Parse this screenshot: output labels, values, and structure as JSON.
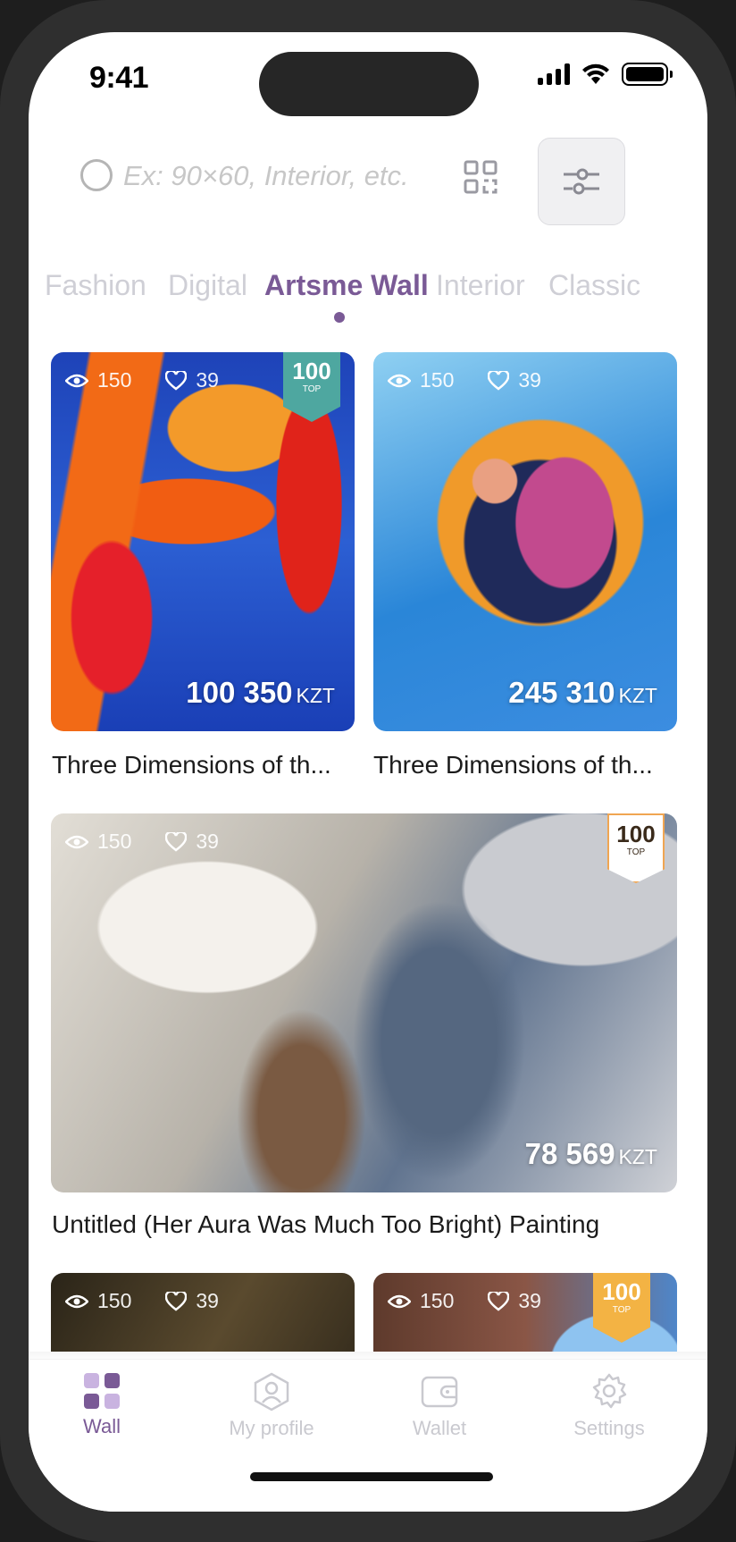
{
  "status_bar": {
    "time": "9:41"
  },
  "search": {
    "placeholder": "Ex: 90×60, Interior, etc.",
    "value": ""
  },
  "tabs": [
    {
      "label": "Fashion",
      "active": false
    },
    {
      "label": "Digital",
      "active": false
    },
    {
      "label": "Artsme Wall",
      "active": true
    },
    {
      "label": "Interior",
      "active": false
    },
    {
      "label": "Classic",
      "active": false
    }
  ],
  "cards": [
    {
      "views": "150",
      "likes": "39",
      "price": "100 350",
      "currency": "KZT",
      "title": "Three Dimensions of th...",
      "badge": {
        "number": "100",
        "label": "TOP"
      }
    },
    {
      "views": "150",
      "likes": "39",
      "price": "245 310",
      "currency": "KZT",
      "title": "Three Dimensions of th..."
    },
    {
      "views": "150",
      "likes": "39",
      "price": "78 569",
      "currency": "KZT",
      "title": "Untitled (Her Aura Was Much Too Bright) Painting",
      "badge": {
        "number": "100",
        "label": "TOP"
      }
    },
    {
      "views": "150",
      "likes": "39"
    },
    {
      "views": "150",
      "likes": "39",
      "badge": {
        "number": "100",
        "label": "TOP"
      }
    }
  ],
  "bottom_nav": [
    {
      "label": "Wall",
      "icon": "grid-icon",
      "active": true
    },
    {
      "label": "My profile",
      "icon": "profile-icon",
      "active": false
    },
    {
      "label": "Wallet",
      "icon": "wallet-icon",
      "active": false
    },
    {
      "label": "Settings",
      "icon": "settings-icon",
      "active": false
    }
  ],
  "colors": {
    "accent": "#7a5a96",
    "inactive": "#c9c9cf"
  }
}
